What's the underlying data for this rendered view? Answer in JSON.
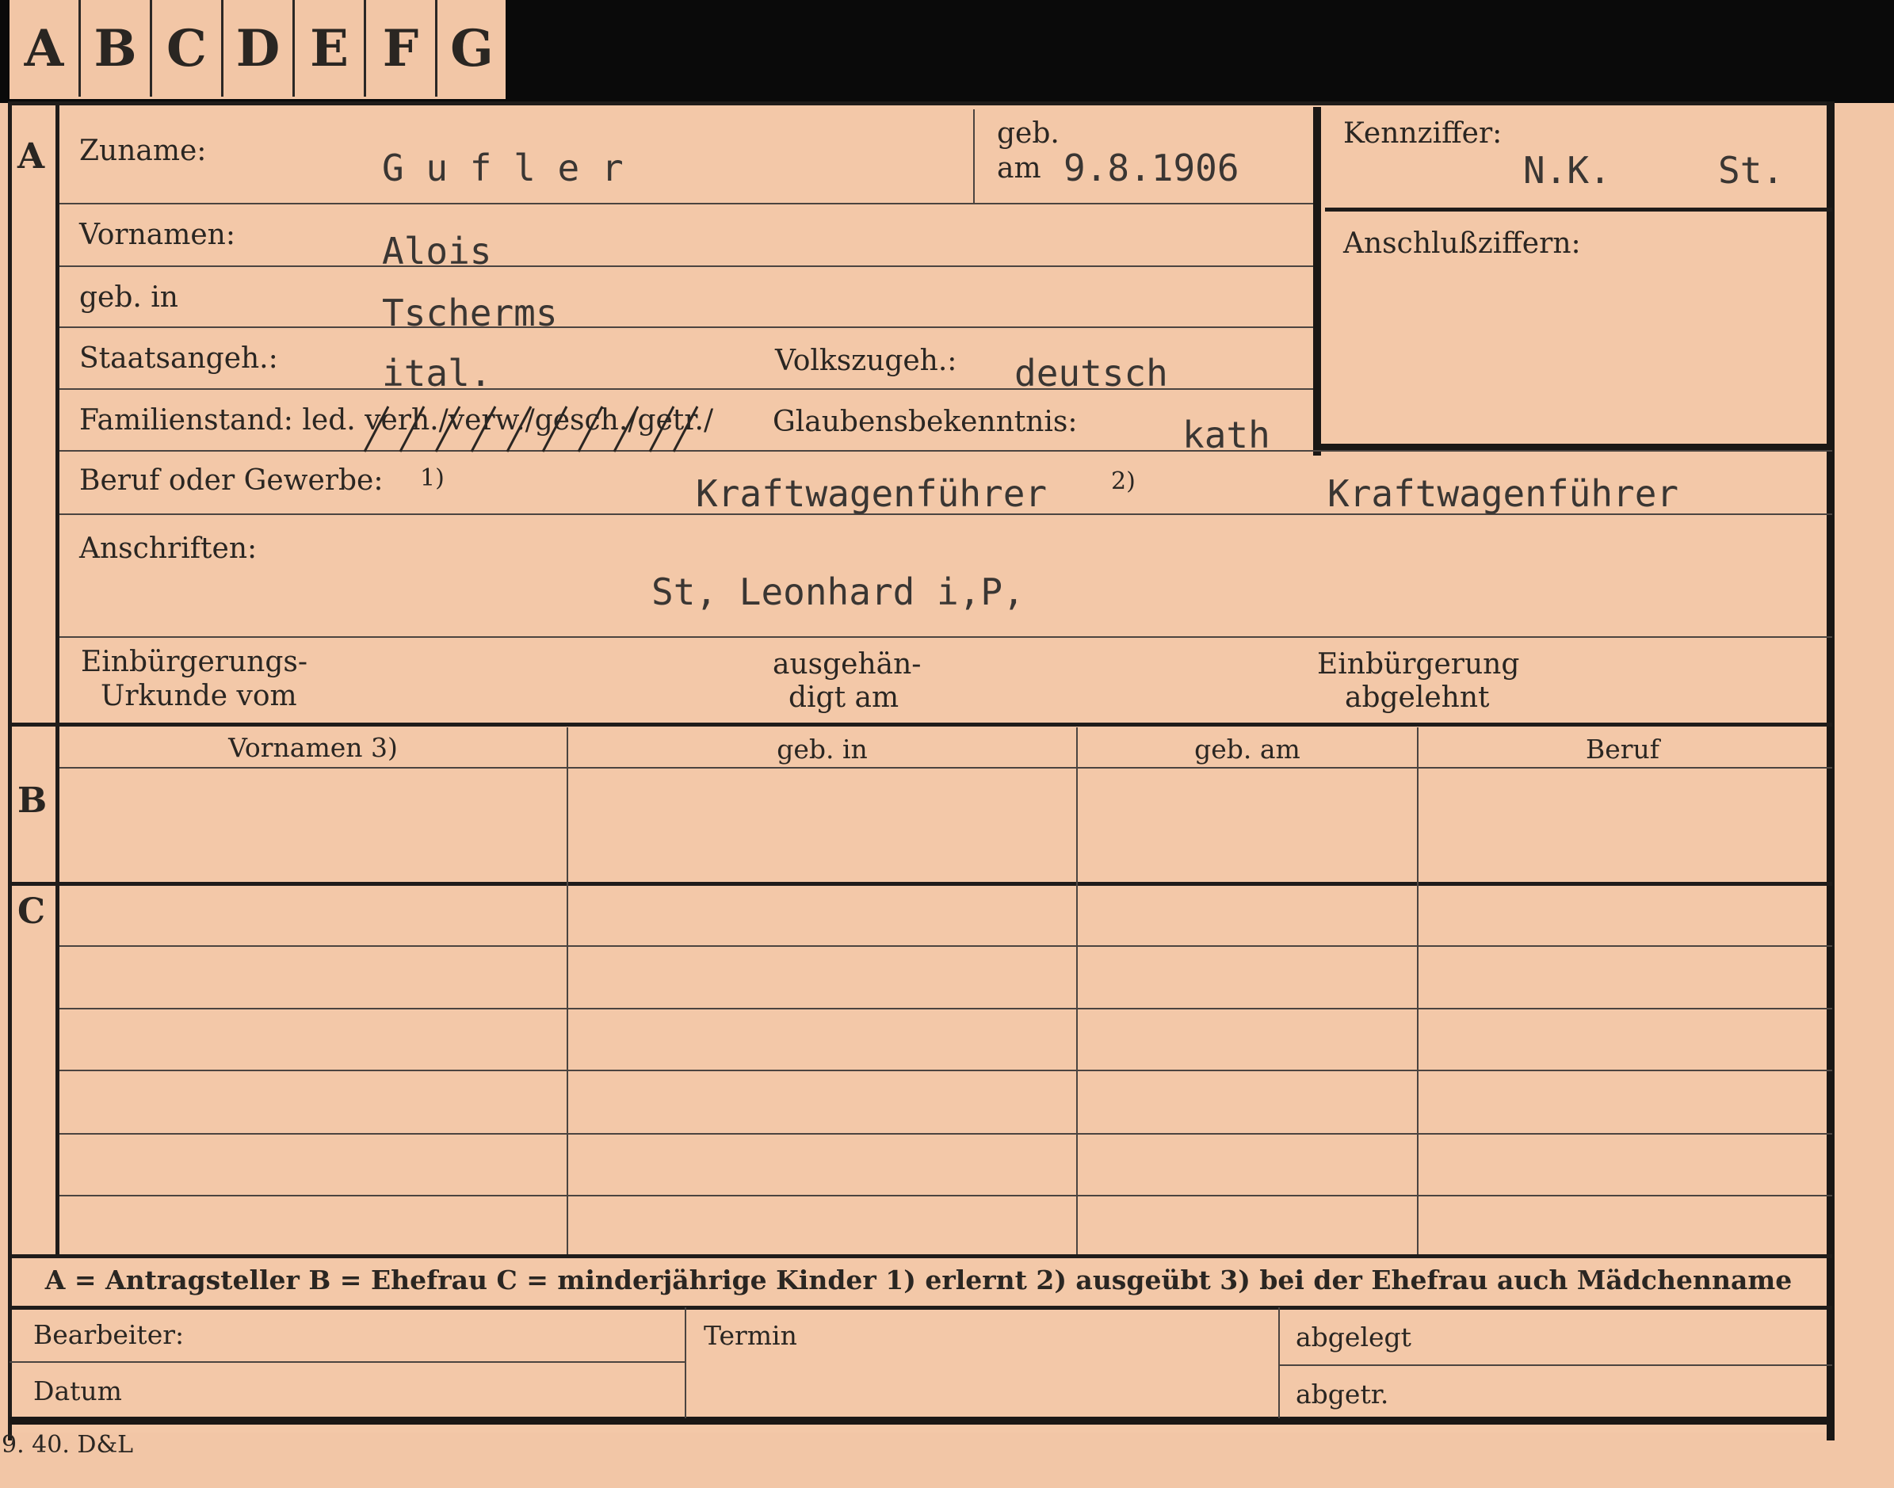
{
  "tabs": [
    "A",
    "B",
    "C",
    "D",
    "E",
    "F",
    "G"
  ],
  "sections": {
    "a": "A",
    "b": "B",
    "c": "C"
  },
  "labels": {
    "zuname": "Zuname:",
    "geb": "geb.",
    "am": "am",
    "kennziffer": "Kennziffer:",
    "anschluss": "Anschlußziffern:",
    "vornamen": "Vornamen:",
    "geb_in": "geb. in",
    "staatsangeh": "Staatsangeh.:",
    "volkszugeh": "Volkszugeh.:",
    "familienstand": "Familienstand: led. verh./verw./gesch./getr./",
    "glauben": "Glaubensbekenntnis:",
    "beruf": "Beruf oder Gewerbe:",
    "beruf_sup1": "1)",
    "beruf_sup2": "2)",
    "anschriften": "Anschriften:",
    "einb_urkunde_1": "Einbürgerungs-",
    "einb_urkunde_2": "Urkunde vom",
    "ausgehaen_1": "ausgehän-",
    "ausgehaen_2": "digt am",
    "einb_abgelehnt_1": "Einbürgerung",
    "einb_abgelehnt_2": "abgelehnt",
    "col_vornamen": "Vornamen 3)",
    "col_geb_in": "geb. in",
    "col_geb_am": "geb. am",
    "col_beruf": "Beruf",
    "legend": "A = Antragsteller   B = Ehefrau   C = minderjährige Kinder   1) erlernt   2) ausgeübt   3) bei der Ehefrau auch Mädchenname",
    "bearbeiter": "Bearbeiter:",
    "termin": "Termin",
    "abgelegt": "abgelegt",
    "datum": "Datum",
    "abgetr": "abgetr.",
    "printmark": "9. 40. D&L"
  },
  "values": {
    "zuname": "G u f l e r",
    "geb_am": "9.8.1906",
    "kennziffer_nk": "N.K.",
    "kennziffer_st": "St.",
    "vornamen": "Alois",
    "geb_in": "Tscherms",
    "staatsangeh": "ital.",
    "volkszugeh": "deutsch",
    "glauben": "kath",
    "beruf_erlernt": "Kraftwagenführer",
    "beruf_ausgeuebt": "Kraftwagenführer",
    "anschrift": "St, Leonhard i,P,"
  }
}
